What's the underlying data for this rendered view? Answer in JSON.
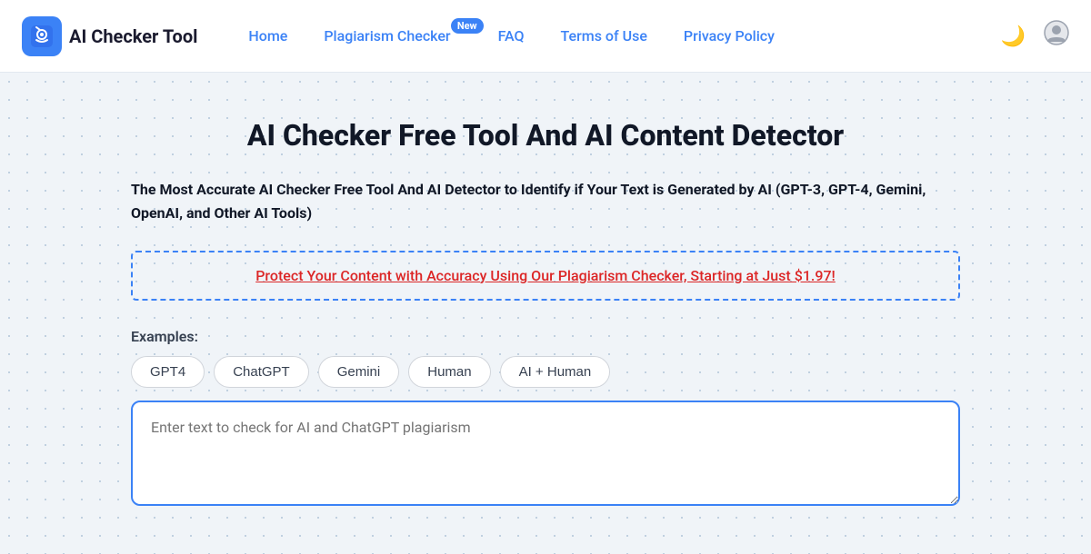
{
  "brand": {
    "icon": "🔍",
    "name": "AI Checker Tool"
  },
  "nav": {
    "links": [
      {
        "id": "home",
        "label": "Home",
        "badge": null
      },
      {
        "id": "plagiarism-checker",
        "label": "Plagiarism Checker",
        "badge": "New"
      },
      {
        "id": "faq",
        "label": "FAQ",
        "badge": null
      },
      {
        "id": "terms",
        "label": "Terms of Use",
        "badge": null
      },
      {
        "id": "privacy",
        "label": "Privacy Policy",
        "badge": null
      }
    ],
    "dark_mode_icon": "🌙",
    "user_icon": "👤"
  },
  "main": {
    "title": "AI Checker Free Tool And AI Content Detector",
    "subtitle": "The Most Accurate AI Checker Free Tool And AI Detector to Identify if Your Text is Generated by AI (GPT-3, GPT-4, Gemini, OpenAI, and Other AI Tools)",
    "promo": {
      "text": "Protect Your Content with Accuracy Using Our Plagiarism Checker, Starting at Just $1.97!"
    },
    "examples": {
      "label": "Examples:",
      "pills": [
        {
          "id": "gpt4",
          "label": "GPT4"
        },
        {
          "id": "chatgpt",
          "label": "ChatGPT"
        },
        {
          "id": "gemini",
          "label": "Gemini"
        },
        {
          "id": "human",
          "label": "Human"
        },
        {
          "id": "ai-human",
          "label": "AI + Human"
        }
      ]
    },
    "textarea": {
      "placeholder": "Enter text to check for AI and ChatGPT plagiarism"
    }
  }
}
